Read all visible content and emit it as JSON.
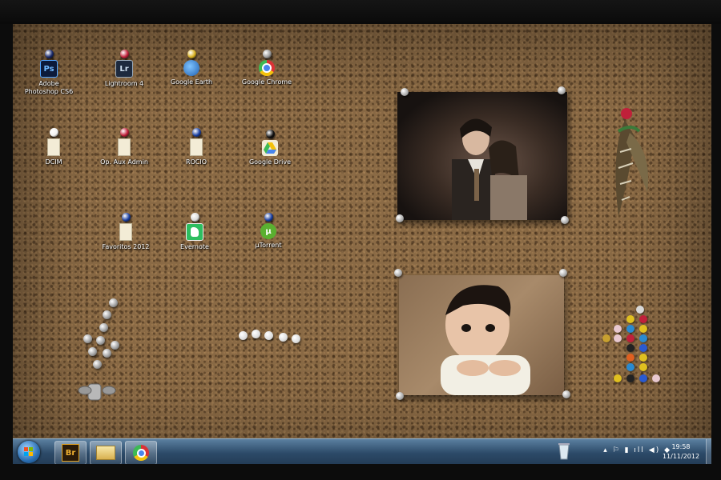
{
  "desktop_icons": [
    {
      "label": "Adobe\nPhotoshop CS6",
      "icon": "photoshop-icon",
      "tile_text": "Ps",
      "pin_color": "#1a2a6a"
    },
    {
      "label": "Lightroom 4",
      "icon": "lightroom-icon",
      "tile_text": "Lr",
      "pin_color": "#c0203a"
    },
    {
      "label": "Google Earth",
      "icon": "google-earth-icon",
      "tile_text": "",
      "pin_color": "#d9b020"
    },
    {
      "label": "Google Chrome",
      "icon": "chrome-icon",
      "tile_text": "",
      "pin_color": "#9a9a9a"
    },
    {
      "label": "DCIM",
      "icon": "folder-icon",
      "tile_text": "",
      "pin_color": "#f0f0f0"
    },
    {
      "label": "Op. Aux Admin",
      "icon": "folder-icon",
      "tile_text": "",
      "pin_color": "#c0203a"
    },
    {
      "label": "ROCIO",
      "icon": "folder-icon",
      "tile_text": "",
      "pin_color": "#1a3fa0"
    },
    {
      "label": "Google Drive",
      "icon": "google-drive-icon",
      "tile_text": "",
      "pin_color": "#111111"
    },
    {
      "label": "Favoritos 2012",
      "icon": "folder-icon",
      "tile_text": "",
      "pin_color": "#1a3fa0"
    },
    {
      "label": "Evernote",
      "icon": "evernote-icon",
      "tile_text": "",
      "pin_color": "#d9d9d9"
    },
    {
      "label": "µTorrent",
      "icon": "utorrent-icon",
      "tile_text": "µ",
      "pin_color": "#1a3fa0"
    }
  ],
  "taskbar": {
    "pinned": [
      {
        "name": "bridge-icon",
        "text": "Br"
      },
      {
        "name": "explorer-icon",
        "text": ""
      },
      {
        "name": "chrome-icon",
        "text": ""
      }
    ],
    "tray_icons": "▴ ⚐ ▮ ıll ◀) ◆",
    "time": "19:58",
    "date": "11/11/2012"
  },
  "colors": {
    "taskbar_top": "#5b7fa0",
    "cork": "#8a6a45"
  }
}
